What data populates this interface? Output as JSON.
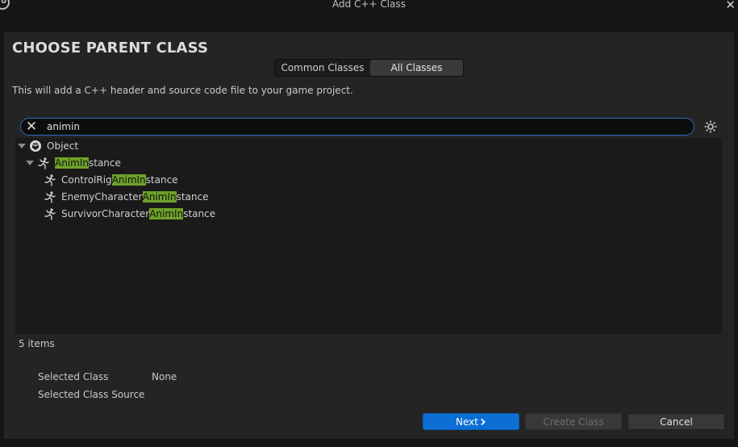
{
  "window": {
    "title": "Add C++ Class"
  },
  "heading": "CHOOSE PARENT CLASS",
  "tabs": {
    "common": "Common Classes",
    "all": "All Classes",
    "active": "all"
  },
  "description": "This will add a C++ header and source code file to your game project.",
  "search": {
    "value": "animin",
    "clear_icon": "close-icon",
    "settings_icon": "gear-icon"
  },
  "tree": {
    "root": {
      "label": "Object",
      "icon": "object-sphere-icon"
    },
    "parent": {
      "pre": "",
      "match": "AnimIn",
      "post": "stance",
      "icon": "anim-instance-icon"
    },
    "children": [
      {
        "pre": "ControlRig",
        "match": "AnimIn",
        "post": "stance",
        "icon": "anim-instance-icon"
      },
      {
        "pre": "EnemyCharacter",
        "match": "AnimIn",
        "post": "stance",
        "icon": "anim-instance-icon"
      },
      {
        "pre": "SurvivorCharacter",
        "match": "AnimIn",
        "post": "stance",
        "icon": "anim-instance-icon"
      }
    ]
  },
  "status": {
    "count": "5 items"
  },
  "details": {
    "selected_class_label": "Selected Class",
    "selected_class_value": "None",
    "selected_source_label": "Selected Class Source",
    "selected_source_value": ""
  },
  "buttons": {
    "next": "Next",
    "create": "Create Class",
    "cancel": "Cancel"
  },
  "colors": {
    "accent": "#0d6fd6",
    "highlight": "#6fa12a",
    "panel": "#242424",
    "focus_border": "#2a6dbd"
  }
}
